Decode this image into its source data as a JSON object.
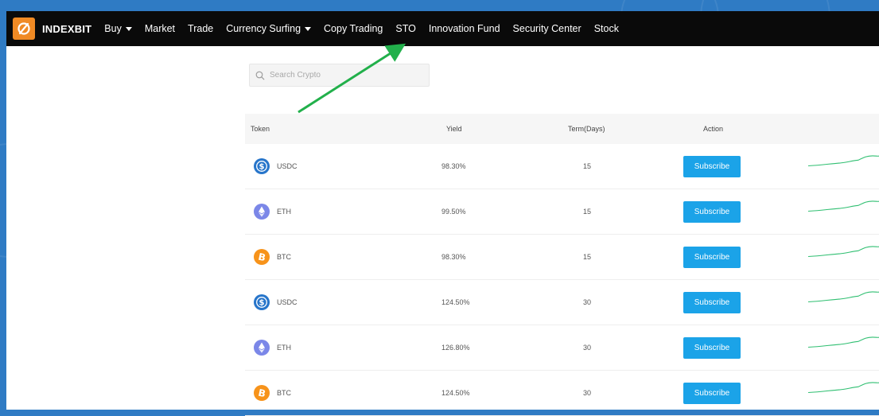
{
  "nav": {
    "brand": "INDEXBIT",
    "items": [
      {
        "label": "Buy",
        "dropdown": true
      },
      {
        "label": "Market",
        "dropdown": false
      },
      {
        "label": "Trade",
        "dropdown": false
      },
      {
        "label": "Currency Surfing",
        "dropdown": true
      },
      {
        "label": "Copy Trading",
        "dropdown": false
      },
      {
        "label": "STO",
        "dropdown": false
      },
      {
        "label": "Innovation Fund",
        "dropdown": false
      },
      {
        "label": "Security Center",
        "dropdown": false
      },
      {
        "label": "Stock",
        "dropdown": false
      }
    ]
  },
  "search": {
    "placeholder": "Search Crypto",
    "value": ""
  },
  "table": {
    "headers": {
      "token": "Token",
      "yield": "Yield",
      "term": "Term(Days)",
      "action": "Action"
    },
    "rows": [
      {
        "token": "USDC",
        "icon": "usdc-icon",
        "yield": "98.30%",
        "term": "15",
        "action": "Subscribe"
      },
      {
        "token": "ETH",
        "icon": "eth-icon",
        "yield": "99.50%",
        "term": "15",
        "action": "Subscribe"
      },
      {
        "token": "BTC",
        "icon": "btc-icon",
        "yield": "98.30%",
        "term": "15",
        "action": "Subscribe"
      },
      {
        "token": "USDC",
        "icon": "usdc-icon",
        "yield": "124.50%",
        "term": "30",
        "action": "Subscribe"
      },
      {
        "token": "ETH",
        "icon": "eth-icon",
        "yield": "126.80%",
        "term": "30",
        "action": "Subscribe"
      },
      {
        "token": "BTC",
        "icon": "btc-icon",
        "yield": "124.50%",
        "term": "30",
        "action": "Subscribe"
      }
    ]
  },
  "colors": {
    "navbar_bg": "#0a0a0a",
    "brand_orange": "#f08a24",
    "subscribe_button": "#1ba3e8",
    "sparkline": "#2fbf71",
    "annotation_arrow": "#22b04b",
    "usdc": "#2775ca",
    "eth": "#7b87e8",
    "btc": "#f7931a"
  }
}
